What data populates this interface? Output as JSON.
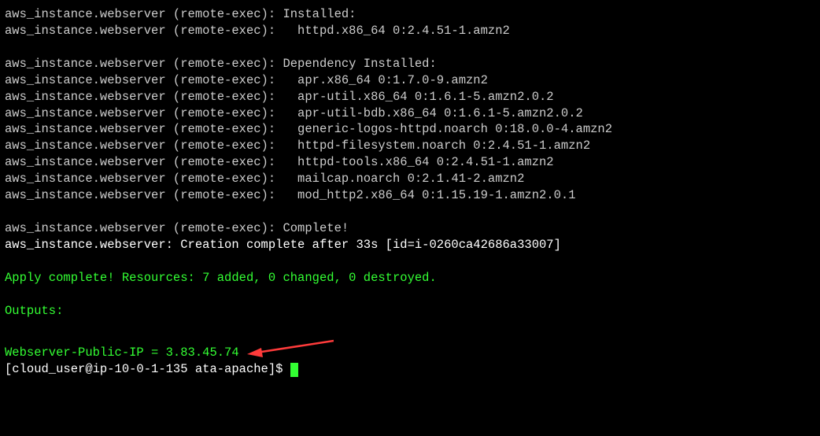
{
  "prefix": "aws_instance.webserver (remote-exec):",
  "lines": [
    {
      "text": " Installed:"
    },
    {
      "text": "   httpd.x86_64 0:2.4.51-1.amzn2"
    }
  ],
  "dep_header": " Dependency Installed:",
  "deps": [
    "   apr.x86_64 0:1.7.0-9.amzn2",
    "   apr-util.x86_64 0:1.6.1-5.amzn2.0.2",
    "   apr-util-bdb.x86_64 0:1.6.1-5.amzn2.0.2",
    "   generic-logos-httpd.noarch 0:18.0.0-4.amzn2",
    "   httpd-filesystem.noarch 0:2.4.51-1.amzn2",
    "   httpd-tools.x86_64 0:2.4.51-1.amzn2",
    "   mailcap.noarch 0:2.1.41-2.amzn2",
    "   mod_http2.x86_64 0:1.15.19-1.amzn2.0.1"
  ],
  "complete": " Complete!",
  "creation": "aws_instance.webserver: Creation complete after 33s [id=i-0260ca42686a33007]",
  "apply": "Apply complete! Resources: 7 added, 0 changed, 0 destroyed.",
  "outputs_label": "Outputs:",
  "output_kv": "Webserver-Public-IP = 3.83.45.74",
  "prompt": "[cloud_user@ip-10-0-1-135 ata-apache]$ ",
  "colors": {
    "green": "#33ff33",
    "text": "#cccccc",
    "bg": "#000000",
    "arrow": "#ff3b3b"
  }
}
